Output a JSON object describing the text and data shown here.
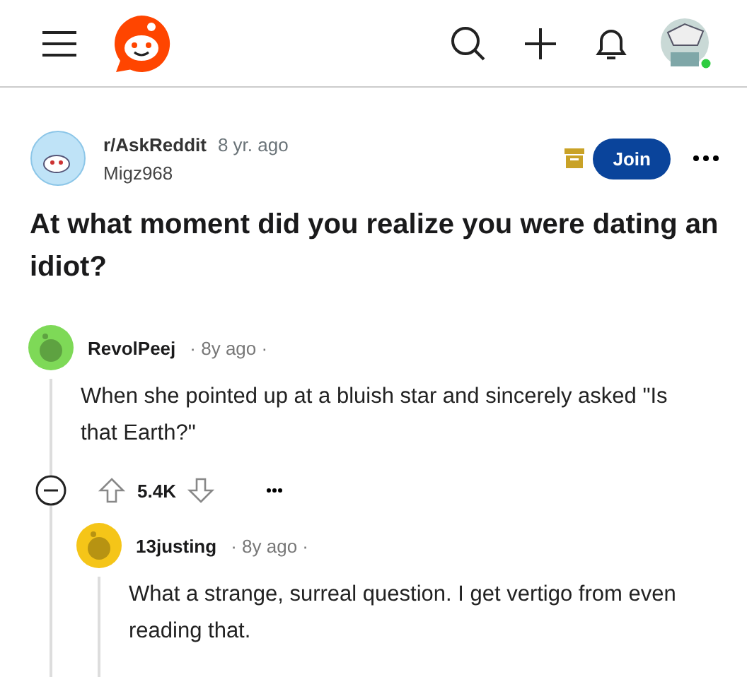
{
  "post": {
    "subreddit": "r/AskReddit",
    "age": "8 yr. ago",
    "author": "Migz968",
    "join": "Join",
    "title": "At what moment did you realize you were dating an idiot?"
  },
  "comments": [
    {
      "author": "RevolPeej",
      "age": "· 8y ago ·",
      "color": "#7ed957",
      "body": "When she pointed up at a bluish star and sincerely asked \"Is that Earth?\"",
      "score": "5.4K",
      "expanded": true,
      "children": [
        {
          "author": "13justing",
          "age": "· 8y ago ·",
          "color": "#f5c518",
          "body": "What a strange, surreal question. I get vertigo from even reading that."
        }
      ]
    }
  ]
}
